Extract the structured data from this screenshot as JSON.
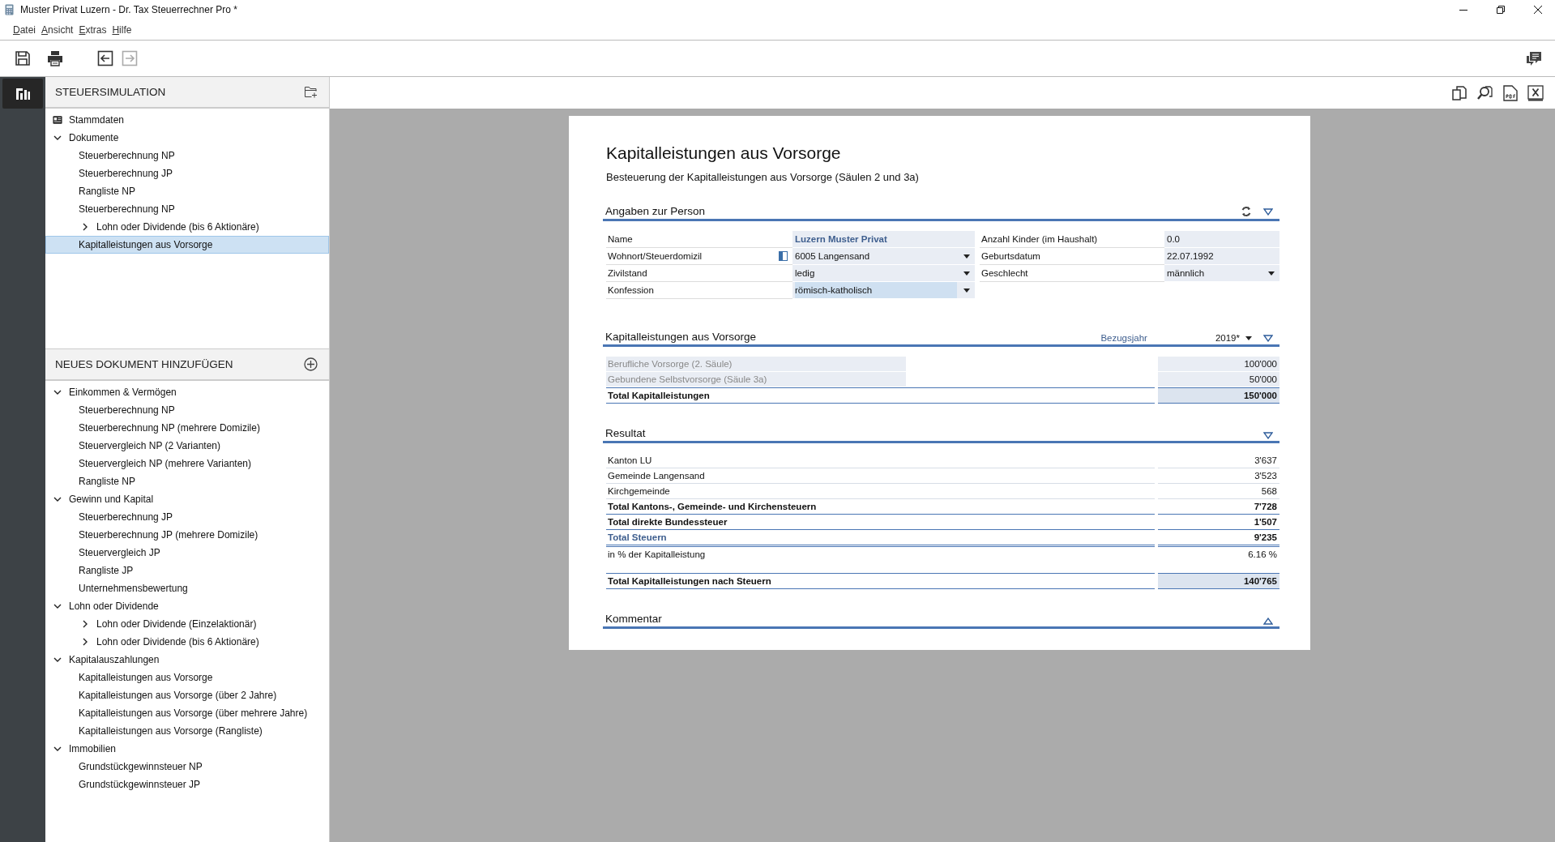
{
  "window": {
    "title": "Muster Privat Luzern - Dr. Tax Steuerrechner Pro *"
  },
  "menu": [
    "Datei",
    "Ansicht",
    "Extras",
    "Hilfe"
  ],
  "toolbar": [
    {
      "kind": "save",
      "disabled": false
    },
    {
      "kind": "print",
      "disabled": false
    },
    {
      "kind": "back",
      "disabled": false
    },
    {
      "kind": "forward",
      "disabled": true
    }
  ],
  "sidebar": {
    "simulation": {
      "title": "STEUERSIMULATION",
      "items": [
        {
          "label": "Stammdaten",
          "kind": "record",
          "selected": false
        },
        {
          "label": "Dokumente",
          "kind": "group",
          "expanded": true,
          "selected": false,
          "children": [
            {
              "label": "Steuerberechnung NP",
              "kind": "doc",
              "selected": false
            },
            {
              "label": "Steuerberechnung JP",
              "kind": "doc",
              "selected": false
            },
            {
              "label": "Rangliste NP",
              "kind": "doc",
              "selected": false
            },
            {
              "label": "Steuerberechnung NP",
              "kind": "doc",
              "selected": false
            },
            {
              "label": "Lohn oder Dividende (bis 6 Aktionäre)",
              "kind": "group",
              "expanded": false,
              "selected": false
            },
            {
              "label": "Kapitalleistungen aus Vorsorge",
              "kind": "doc",
              "selected": true
            }
          ]
        }
      ]
    },
    "new_document": {
      "title": "NEUES DOKUMENT HINZUFÜGEN",
      "items": [
        {
          "label": "Einkommen & Vermögen",
          "kind": "group",
          "expanded": true,
          "selected": false,
          "children": [
            {
              "label": "Steuerberechnung NP",
              "kind": "doc",
              "selected": false
            },
            {
              "label": "Steuerberechnung NP (mehrere Domizile)",
              "kind": "doc",
              "selected": false
            },
            {
              "label": "Steuervergleich NP (2 Varianten)",
              "kind": "doc",
              "selected": false
            },
            {
              "label": "Steuervergleich NP (mehrere Varianten)",
              "kind": "doc",
              "selected": false
            },
            {
              "label": "Rangliste NP",
              "kind": "doc",
              "selected": false
            }
          ]
        },
        {
          "label": "Gewinn und Kapital",
          "kind": "group",
          "expanded": true,
          "selected": false,
          "children": [
            {
              "label": "Steuerberechnung JP",
              "kind": "doc",
              "selected": false
            },
            {
              "label": "Steuerberechnung JP (mehrere Domizile)",
              "kind": "doc",
              "selected": false
            },
            {
              "label": "Steuervergleich JP",
              "kind": "doc",
              "selected": false
            },
            {
              "label": "Rangliste JP",
              "kind": "doc",
              "selected": false
            },
            {
              "label": "Unternehmensbewertung",
              "kind": "doc",
              "selected": false
            }
          ]
        },
        {
          "label": "Lohn oder Dividende",
          "kind": "group",
          "expanded": true,
          "selected": false,
          "children": [
            {
              "label": "Lohn oder Dividende (Einzelaktionär)",
              "kind": "group",
              "expanded": false,
              "selected": false
            },
            {
              "label": "Lohn oder Dividende (bis 6 Aktionäre)",
              "kind": "group",
              "expanded": false,
              "selected": false
            }
          ]
        },
        {
          "label": "Kapitalauszahlungen",
          "kind": "group",
          "expanded": true,
          "selected": false,
          "children": [
            {
              "label": "Kapitalleistungen aus Vorsorge",
              "kind": "doc",
              "selected": false
            },
            {
              "label": "Kapitalleistungen aus Vorsorge (über 2 Jahre)",
              "kind": "doc",
              "selected": false
            },
            {
              "label": "Kapitalleistungen aus Vorsorge (über mehrere Jahre)",
              "kind": "doc",
              "selected": false
            },
            {
              "label": "Kapitalleistungen aus Vorsorge (Rangliste)",
              "kind": "doc",
              "selected": false
            }
          ]
        },
        {
          "label": "Immobilien",
          "kind": "group",
          "expanded": true,
          "selected": false,
          "children": [
            {
              "label": "Grundstückgewinnsteuer NP",
              "kind": "doc",
              "selected": false
            },
            {
              "label": "Grundstückgewinnsteuer JP",
              "kind": "doc",
              "selected": false
            }
          ]
        }
      ]
    }
  },
  "document": {
    "title": "Kapitalleistungen aus Vorsorge",
    "subtitle": "Besteuerung der Kapitalleistungen aus Vorsorge (Säulen 2 und 3a)",
    "person": {
      "title": "Angaben zur Person",
      "expanded": true,
      "left_fields": [
        {
          "label": "Name",
          "value": "Luzern Muster Privat",
          "kind": "title"
        },
        {
          "label": "Wohnort/Steuerdomizil",
          "value": "6005 Langensand",
          "kind": "dropdown",
          "lookup": true
        },
        {
          "label": "Zivilstand",
          "value": "ledig",
          "kind": "dropdown"
        },
        {
          "label": "Konfession",
          "value": "römisch-katholisch",
          "kind": "dropdown",
          "focused": true
        }
      ],
      "right_fields": [
        {
          "label": "Anzahl Kinder (im Haushalt)",
          "value": "0.0",
          "kind": "text"
        },
        {
          "label": "Geburtsdatum",
          "value": "22.07.1992",
          "kind": "text"
        },
        {
          "label": "Geschlecht",
          "value": "männlich",
          "kind": "dropdown"
        }
      ]
    },
    "capital": {
      "title": "Kapitalleistungen aus Vorsorge",
      "year_label": "Bezugsjahr",
      "year": "2019*",
      "expanded": true,
      "rows": [
        {
          "label": "Berufliche Vorsorge (2. Säule)",
          "value": "100'000",
          "kind": "input"
        },
        {
          "label": "Gebundene Selbstvorsorge (Säule 3a)",
          "value": "50'000",
          "kind": "input"
        },
        {
          "label": "Total Kapitalleistungen",
          "value": "150'000",
          "kind": "final"
        }
      ]
    },
    "result": {
      "title": "Resultat",
      "expanded": true,
      "rows": [
        {
          "label": "Kanton LU",
          "value": "3'637",
          "kind": "line"
        },
        {
          "label": "Gemeinde Langensand",
          "value": "3'523",
          "kind": "line"
        },
        {
          "label": "Kirchgemeinde",
          "value": "568",
          "kind": "line"
        },
        {
          "label": "Total Kantons-, Gemeinde- und Kirchensteuern",
          "value": "7'728",
          "kind": "total"
        },
        {
          "label": "Total direkte Bundessteuer",
          "value": "1'507",
          "kind": "total"
        },
        {
          "label": "Total Steuern",
          "value": "9'235",
          "kind": "sum"
        },
        {
          "label": "in % der Kapitalleistung",
          "value": "6.16 %",
          "kind": "note"
        },
        {
          "label": "Total Kapitalleistungen nach Steuern",
          "value": "140'765",
          "kind": "final"
        }
      ]
    },
    "comment": {
      "title": "Kommentar",
      "expanded": false
    }
  }
}
